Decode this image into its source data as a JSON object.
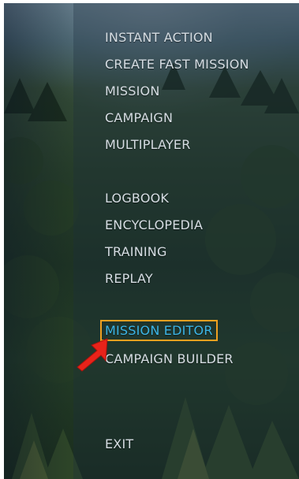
{
  "menu": {
    "items": [
      {
        "label": "INSTANT ACTION"
      },
      {
        "label": "CREATE FAST MISSION"
      },
      {
        "label": "MISSION"
      },
      {
        "label": "CAMPAIGN"
      },
      {
        "label": "MULTIPLAYER"
      },
      {
        "label": "LOGBOOK"
      },
      {
        "label": "ENCYCLOPEDIA"
      },
      {
        "label": "TRAINING"
      },
      {
        "label": "REPLAY"
      },
      {
        "label": "MISSION EDITOR",
        "highlighted": true
      },
      {
        "label": "CAMPAIGN BUILDER"
      },
      {
        "label": "EXIT"
      }
    ]
  },
  "colors": {
    "menu_text": "#d6dde3",
    "highlight_text": "#3bb4e6",
    "highlight_border": "#f0a020",
    "arrow": "#e8231a"
  },
  "annotation": {
    "icon": "red-arrow-icon"
  }
}
